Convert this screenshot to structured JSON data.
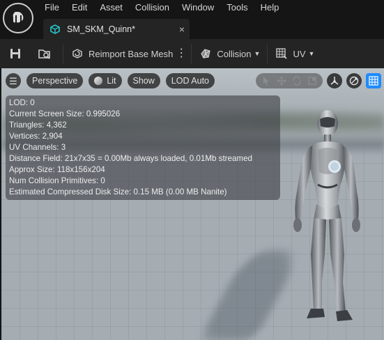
{
  "menu": {
    "items": [
      "File",
      "Edit",
      "Asset",
      "Collision",
      "Window",
      "Tools",
      "Help"
    ]
  },
  "tab": {
    "icon": "skeletal-mesh-icon",
    "label": "SM_SKM_Quinn*",
    "close": "×"
  },
  "toolbar": {
    "save_icon": "save-icon",
    "browse_icon": "browse-asset-icon",
    "reimport_label": "Reimport Base Mesh",
    "collision_label": "Collision",
    "uv_label": "UV"
  },
  "viewport": {
    "perspective_label": "Perspective",
    "lit_label": "Lit",
    "show_label": "Show",
    "lod_label": "LOD Auto"
  },
  "stats": {
    "lines": [
      "LOD:  0",
      "Current Screen Size:  0.995026",
      "Triangles:  4,362",
      "Vertices:  2,904",
      "UV Channels:  3",
      "Distance Field:  21x7x35 = 0.00Mb always loaded, 0.01Mb streamed",
      "Approx Size: 118x156x204",
      "Num Collision Primitives:  0",
      "Estimated Compressed Disk Size: 0.15 MB (0.00 MB Nanite)"
    ]
  },
  "colors": {
    "accent": "#1f8bff",
    "tab_icon": "#27c4c4"
  }
}
